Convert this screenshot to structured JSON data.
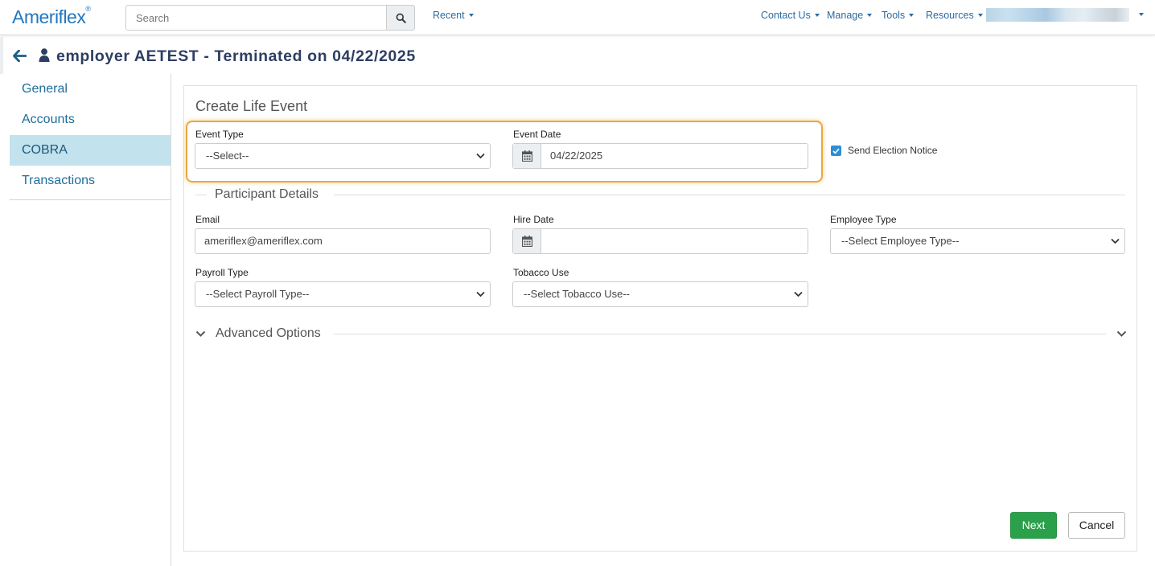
{
  "brand": {
    "logo": "Ameriflex",
    "logo_mark": "®"
  },
  "search": {
    "placeholder": "Search"
  },
  "nav": {
    "recent": "Recent",
    "contact_us": "Contact Us",
    "manage": "Manage",
    "tools": "Tools",
    "resources": "Resources"
  },
  "header": {
    "title": "employer AETEST - Terminated on 04/22/2025"
  },
  "sidebar": {
    "items": [
      {
        "label": "General"
      },
      {
        "label": "Accounts"
      },
      {
        "label": "COBRA",
        "active": true
      },
      {
        "label": "Transactions"
      }
    ]
  },
  "form": {
    "title": "Create Life Event",
    "event_type": {
      "label": "Event Type",
      "value": "--Select--"
    },
    "event_date": {
      "label": "Event Date",
      "value": "04/22/2025"
    },
    "send_notice": {
      "label": "Send Election Notice",
      "checked": true
    },
    "participant_section": "Participant Details",
    "email": {
      "label": "Email",
      "value": "ameriflex@ameriflex.com"
    },
    "hire_date": {
      "label": "Hire Date",
      "value": ""
    },
    "employee_type": {
      "label": "Employee Type",
      "value": "--Select Employee Type--"
    },
    "payroll_type": {
      "label": "Payroll Type",
      "value": "--Select Payroll Type--"
    },
    "tobacco_use": {
      "label": "Tobacco Use",
      "value": "--Select Tobacco Use--"
    },
    "advanced_section": "Advanced Options",
    "next_label": "Next",
    "cancel_label": "Cancel"
  },
  "colors": {
    "brand_blue": "#2277c0",
    "nav_link": "#2b6aa0",
    "title_navy": "#2c3e62",
    "sidebar_active_bg": "#c2e2ee",
    "highlight_orange": "#e8a93c",
    "next_green": "#2aa04a",
    "checkbox_blue": "#2d8fd5"
  }
}
